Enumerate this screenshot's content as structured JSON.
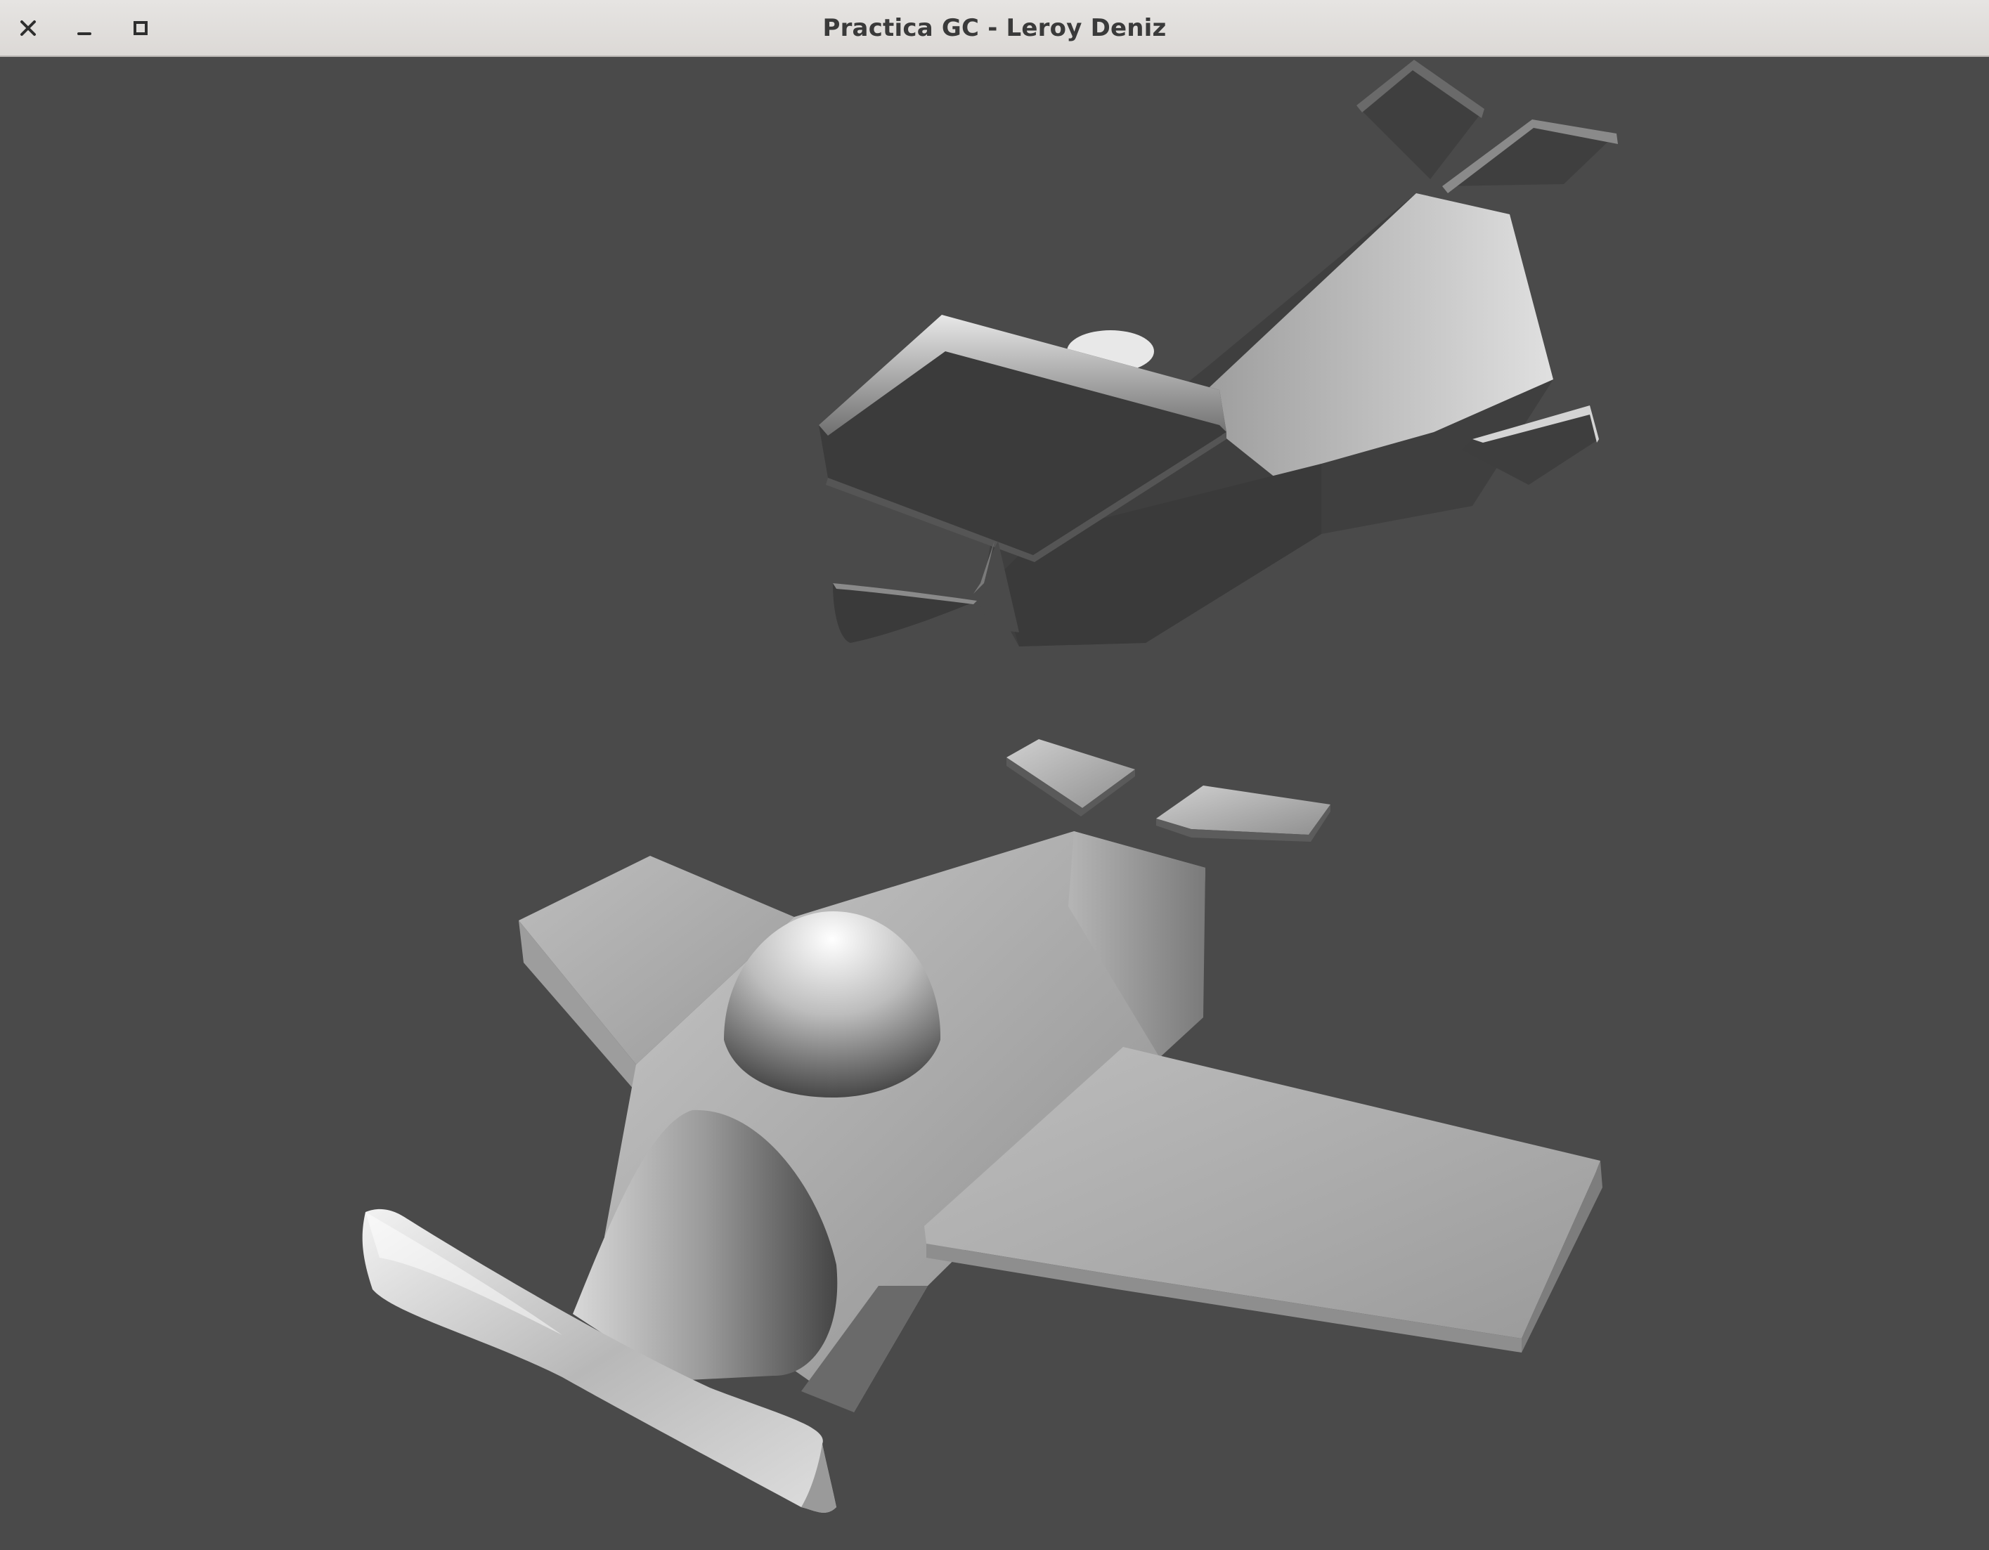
{
  "window": {
    "title": "Practica GC - Leroy Deniz",
    "controls": {
      "close_icon": "close-icon",
      "minimize_icon": "minimize-icon",
      "maximize_icon": "maximize-icon"
    }
  },
  "scene": {
    "background_color": "#4a4a4a",
    "objects": [
      "airplane-front",
      "airplane-back"
    ]
  }
}
